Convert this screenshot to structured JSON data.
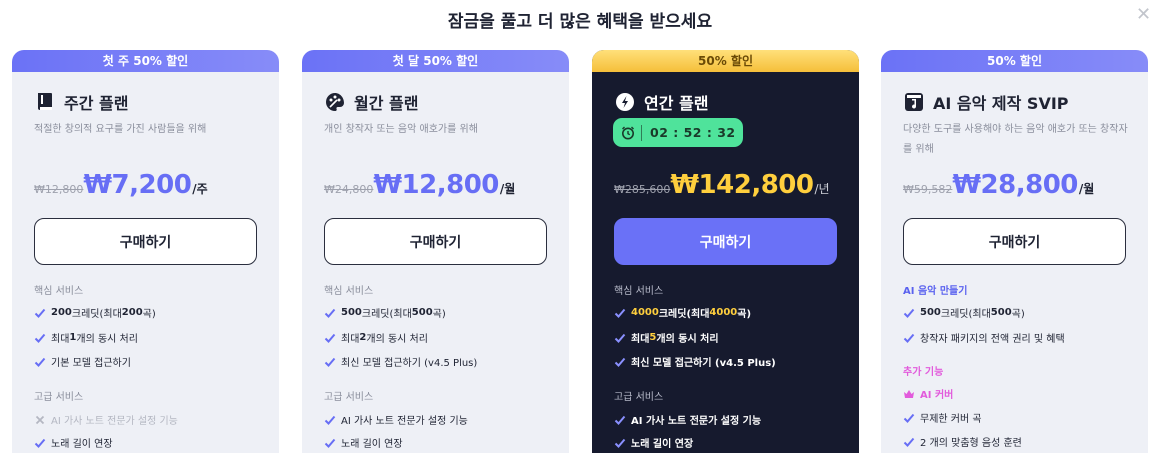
{
  "header": {
    "title": "잠금을 풀고 더 많은 혜택을 받으세요",
    "close_icon": "close-icon"
  },
  "colors": {
    "accent": "#6a71f7",
    "dark_card": "#161a2e",
    "gold": "#ffcf3d",
    "timer_green": "#4fe39b",
    "pink": "#e25bdc"
  },
  "plans": [
    {
      "banner": "첫 주 50% 할인",
      "name": "주간 플랜",
      "icon": "book-icon",
      "desc": "적절한 창의적 요구를 가진 사람들을 위해",
      "old_price": "₩12,800",
      "price": "₩7,200",
      "period": "/주",
      "button": "구매하기",
      "section1": "핵심 서비스",
      "features1": [
        {
          "bold": "200",
          "text": "크레딧(최대 ",
          "bold2": "200",
          "tail": "곡)"
        },
        {
          "pre": "최대 ",
          "bold": "1",
          "text": "개의 동시 처리"
        },
        {
          "text": "기본 모델 접근하기"
        }
      ],
      "section2": "고급 서비스",
      "features2": [
        {
          "text": "AI 가사 노트 전문가 설정 기능",
          "off": true
        },
        {
          "text": "노래 길이 연장"
        }
      ]
    },
    {
      "banner": "첫 달 50% 할인",
      "name": "월간 플랜",
      "icon": "palette-icon",
      "desc": "개인 창작자 또는 음악 애호가를 위해",
      "old_price": "₩24,800",
      "price": "₩12,800",
      "period": "/월",
      "button": "구매하기",
      "section1": "핵심 서비스",
      "features1": [
        {
          "bold": "500",
          "text": "크레딧(최대 ",
          "bold2": "500",
          "tail": "곡)"
        },
        {
          "pre": "최대 ",
          "bold": "2",
          "text": "개의 동시 처리"
        },
        {
          "text": "최신 모델 접근하기 (v4.5 Plus)"
        }
      ],
      "section2": "고급 서비스",
      "features2": [
        {
          "text": "AI 가사 노트 전문가 설정 기능"
        },
        {
          "text": "노래 길이 연장"
        }
      ]
    },
    {
      "banner": "50% 할인",
      "name": "연간 플랜",
      "icon": "rocket-icon",
      "timer": "02 : 52 : 32",
      "old_price": "₩285,600",
      "price": "₩142,800",
      "period": "/년",
      "button": "구매하기",
      "section1": "핵심 서비스",
      "features1": [
        {
          "bold": "4000",
          "text": "크레딧(최대 ",
          "bold2": "4000",
          "tail": "곡)"
        },
        {
          "pre": "최대 ",
          "bold": "5",
          "text": "개의 동시 처리"
        },
        {
          "text": "최신 모델 접근하기 (v4.5 Plus)"
        }
      ],
      "section2": "고급 서비스",
      "features2": [
        {
          "text": "AI 가사 노트 전문가 설정 기능"
        },
        {
          "text": "노래 길이 연장"
        }
      ]
    },
    {
      "banner": "50% 할인",
      "name": "AI 음악 제작 SVIP",
      "icon": "music-note-icon",
      "desc": "다양한 도구를 사용해야 하는 음악 애호가 또는 창작자를 위해",
      "old_price": "₩59,582",
      "price": "₩28,800",
      "period": "/월",
      "button": "구매하기",
      "section1": "AI 음악 만들기",
      "features1": [
        {
          "bold": "500",
          "text": "크레딧(최대 ",
          "bold2": "500",
          "tail": "곡)"
        },
        {
          "text": "창작자 패키지의 전액 권리 및 혜택"
        }
      ],
      "section2": "추가 기능",
      "extra": "AI 커버",
      "features2": [
        {
          "text": "무제한 커버 곡"
        },
        {
          "text": "2 개의 맞춤형 음성 훈련"
        }
      ]
    }
  ]
}
